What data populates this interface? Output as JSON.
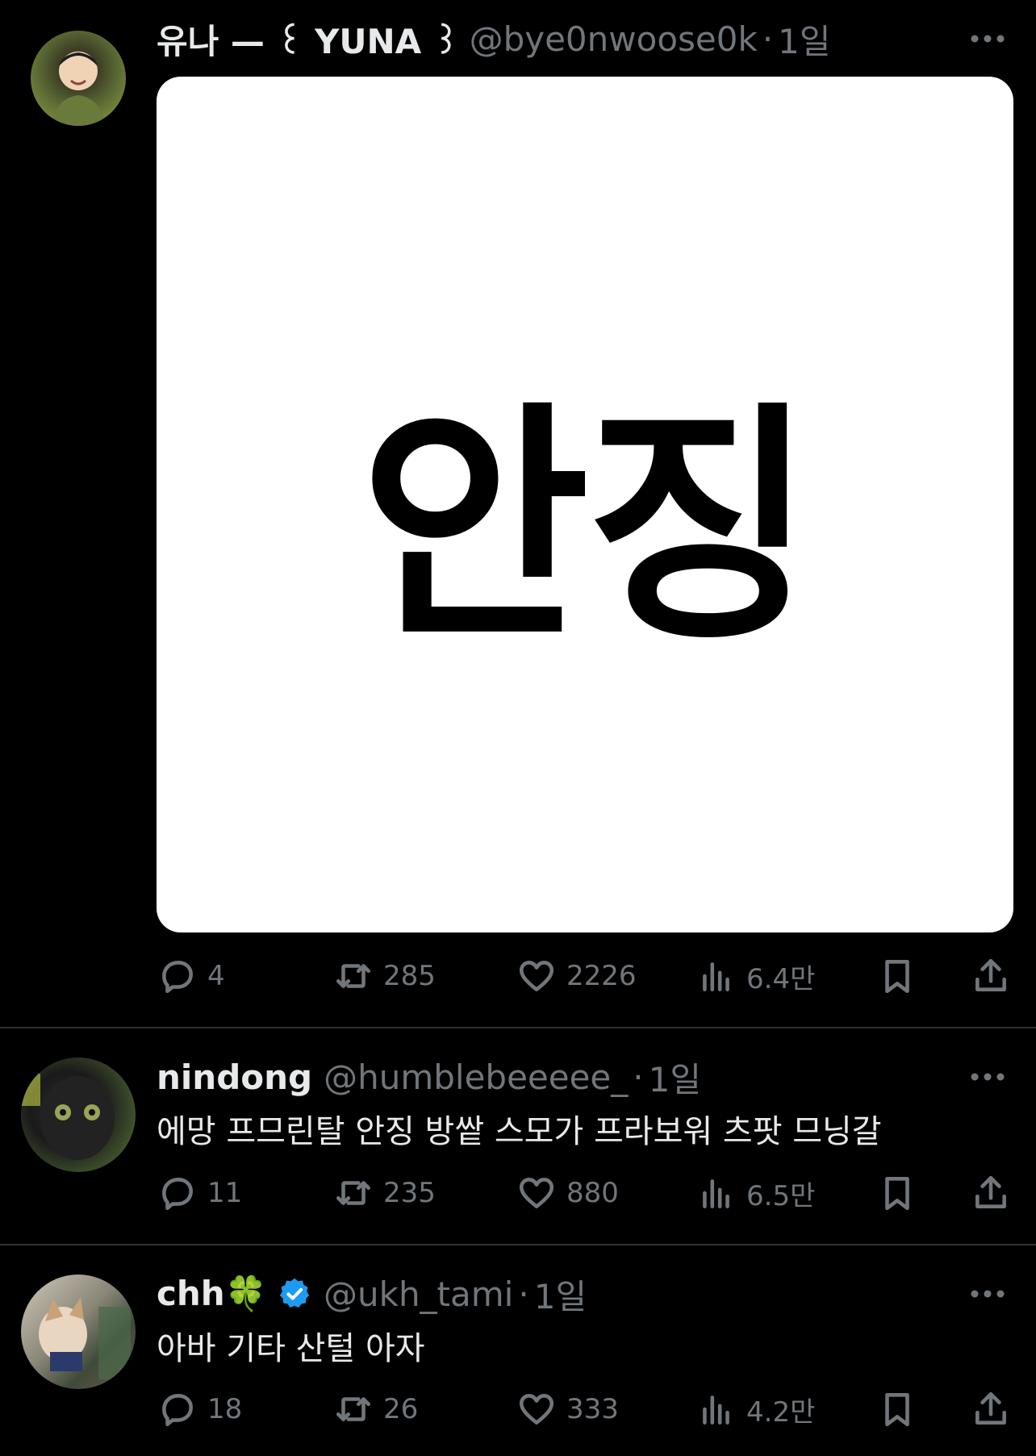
{
  "colors": {
    "background": "#000000",
    "text_primary": "#e7e9ea",
    "text_secondary": "#71767b",
    "verified_badge": "#1d9bf0",
    "separator": "#2f3336"
  },
  "tweets": [
    {
      "display_name": "유나 — ꒰ YUNA ꒱",
      "handle": "@bye0nwoose0k",
      "dot": "·",
      "time": "1일",
      "media_text": "안징",
      "replies": "4",
      "retweets": "285",
      "likes": "2226",
      "views": "6.4만",
      "more_icon": "more-dots-icon"
    },
    {
      "display_name": "nindong",
      "handle": "@humblebeeeee_",
      "dot": "·",
      "time": "1일",
      "text": "에망 프므린탈 안징 방쌑 스모가 프라보워 츠팟 므닝갈",
      "replies": "11",
      "retweets": "235",
      "likes": "880",
      "views": "6.5만",
      "more_icon": "more-dots-icon"
    },
    {
      "display_name": "chh🍀",
      "handle": "@ukh_tami",
      "dot": "·",
      "time": "1일",
      "text": "아바 기타 산털 아자",
      "replies": "18",
      "retweets": "26",
      "likes": "333",
      "views": "4.2만",
      "verified": true,
      "more_icon": "more-dots-icon"
    }
  ],
  "icons": {
    "reply": "reply-icon",
    "retweet": "retweet-icon",
    "like": "heart-icon",
    "views": "views-chart-icon",
    "bookmark": "bookmark-icon",
    "share": "share-icon"
  }
}
